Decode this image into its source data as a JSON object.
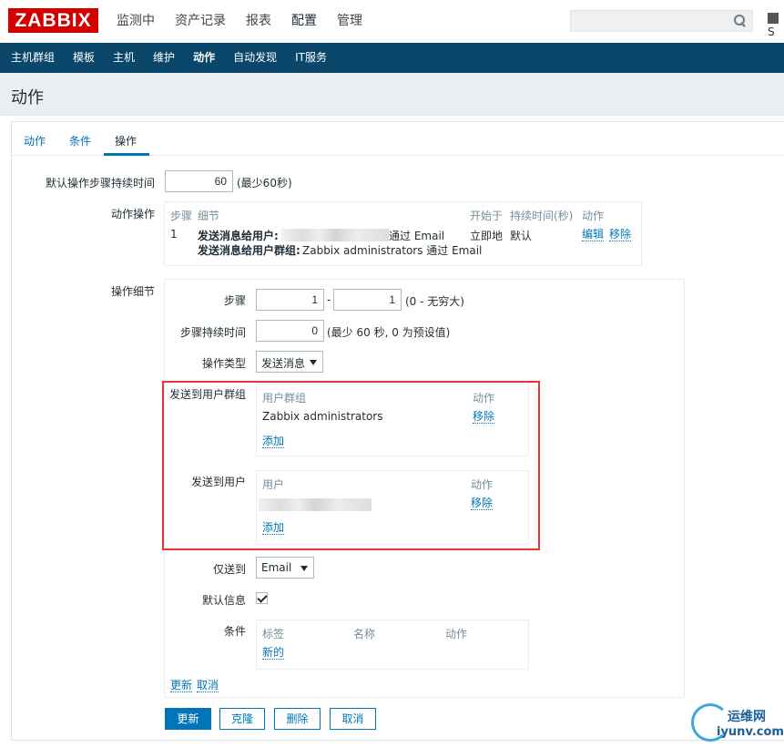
{
  "header": {
    "logo": "ZABBIX",
    "menu": [
      "监测中",
      "资产记录",
      "报表",
      "配置",
      "管理"
    ],
    "active_menu": "配置",
    "share_label": "S"
  },
  "subnav": [
    "主机群组",
    "模板",
    "主机",
    "维护",
    "动作",
    "自动发现",
    "IT服务"
  ],
  "page_title": "动作",
  "tabs": [
    "动作",
    "条件",
    "操作"
  ],
  "form": {
    "default_duration_label": "默认操作步骤持续时间",
    "default_duration_value": "60",
    "default_duration_hint": "(最少60秒)",
    "operations_label": "动作操作",
    "operations_table": {
      "headers": [
        "步骤",
        "细节",
        "开始于",
        "持续时间(秒)",
        "动作"
      ],
      "row": {
        "step": "1",
        "detail_line1_prefix": "发送消息给用户:",
        "detail_line1_suffix": "通过 Email",
        "detail_line2_prefix": "发送消息给用户群组:",
        "detail_line2_suffix": "Zabbix administrators 通过 Email",
        "start": "立即地",
        "duration": "默认",
        "edit": "编辑",
        "remove": "移除"
      }
    },
    "details_label": "操作细节",
    "step_label": "步骤",
    "step_from": "1",
    "step_sep": "-",
    "step_to": "1",
    "step_hint": "(0 - 无穷大)",
    "step_duration_label": "步骤持续时间",
    "step_duration_value": "0",
    "step_duration_hint": "(最少 60 秒, 0 为预设值)",
    "op_type_label": "操作类型",
    "op_type_value": "发送消息",
    "send_groups_label": "发送到用户群组",
    "groups_table": {
      "col1": "用户群组",
      "col2": "动作",
      "row_name": "Zabbix administrators",
      "row_action": "移除",
      "add": "添加"
    },
    "send_users_label": "发送到用户",
    "users_table": {
      "col1": "用户",
      "col2": "动作",
      "row_action": "移除",
      "add": "添加"
    },
    "only_send_label": "仅送到",
    "only_send_value": "Email",
    "default_msg_label": "默认信息",
    "default_msg_checked": true,
    "conditions_label": "条件",
    "conditions_table": {
      "col1": "标签",
      "col2": "名称",
      "col3": "动作",
      "new": "新的"
    },
    "update_link": "更新",
    "cancel_link": "取消"
  },
  "buttons": {
    "update": "更新",
    "clone": "克隆",
    "delete": "删除",
    "cancel": "取消"
  },
  "watermark": {
    "top": "运维网",
    "bottom": "iyunv.com"
  },
  "colors": {
    "logo": "#d40000",
    "subnav": "#0a466a",
    "link": "#0275b8",
    "highlight_box": "#e0353b"
  }
}
